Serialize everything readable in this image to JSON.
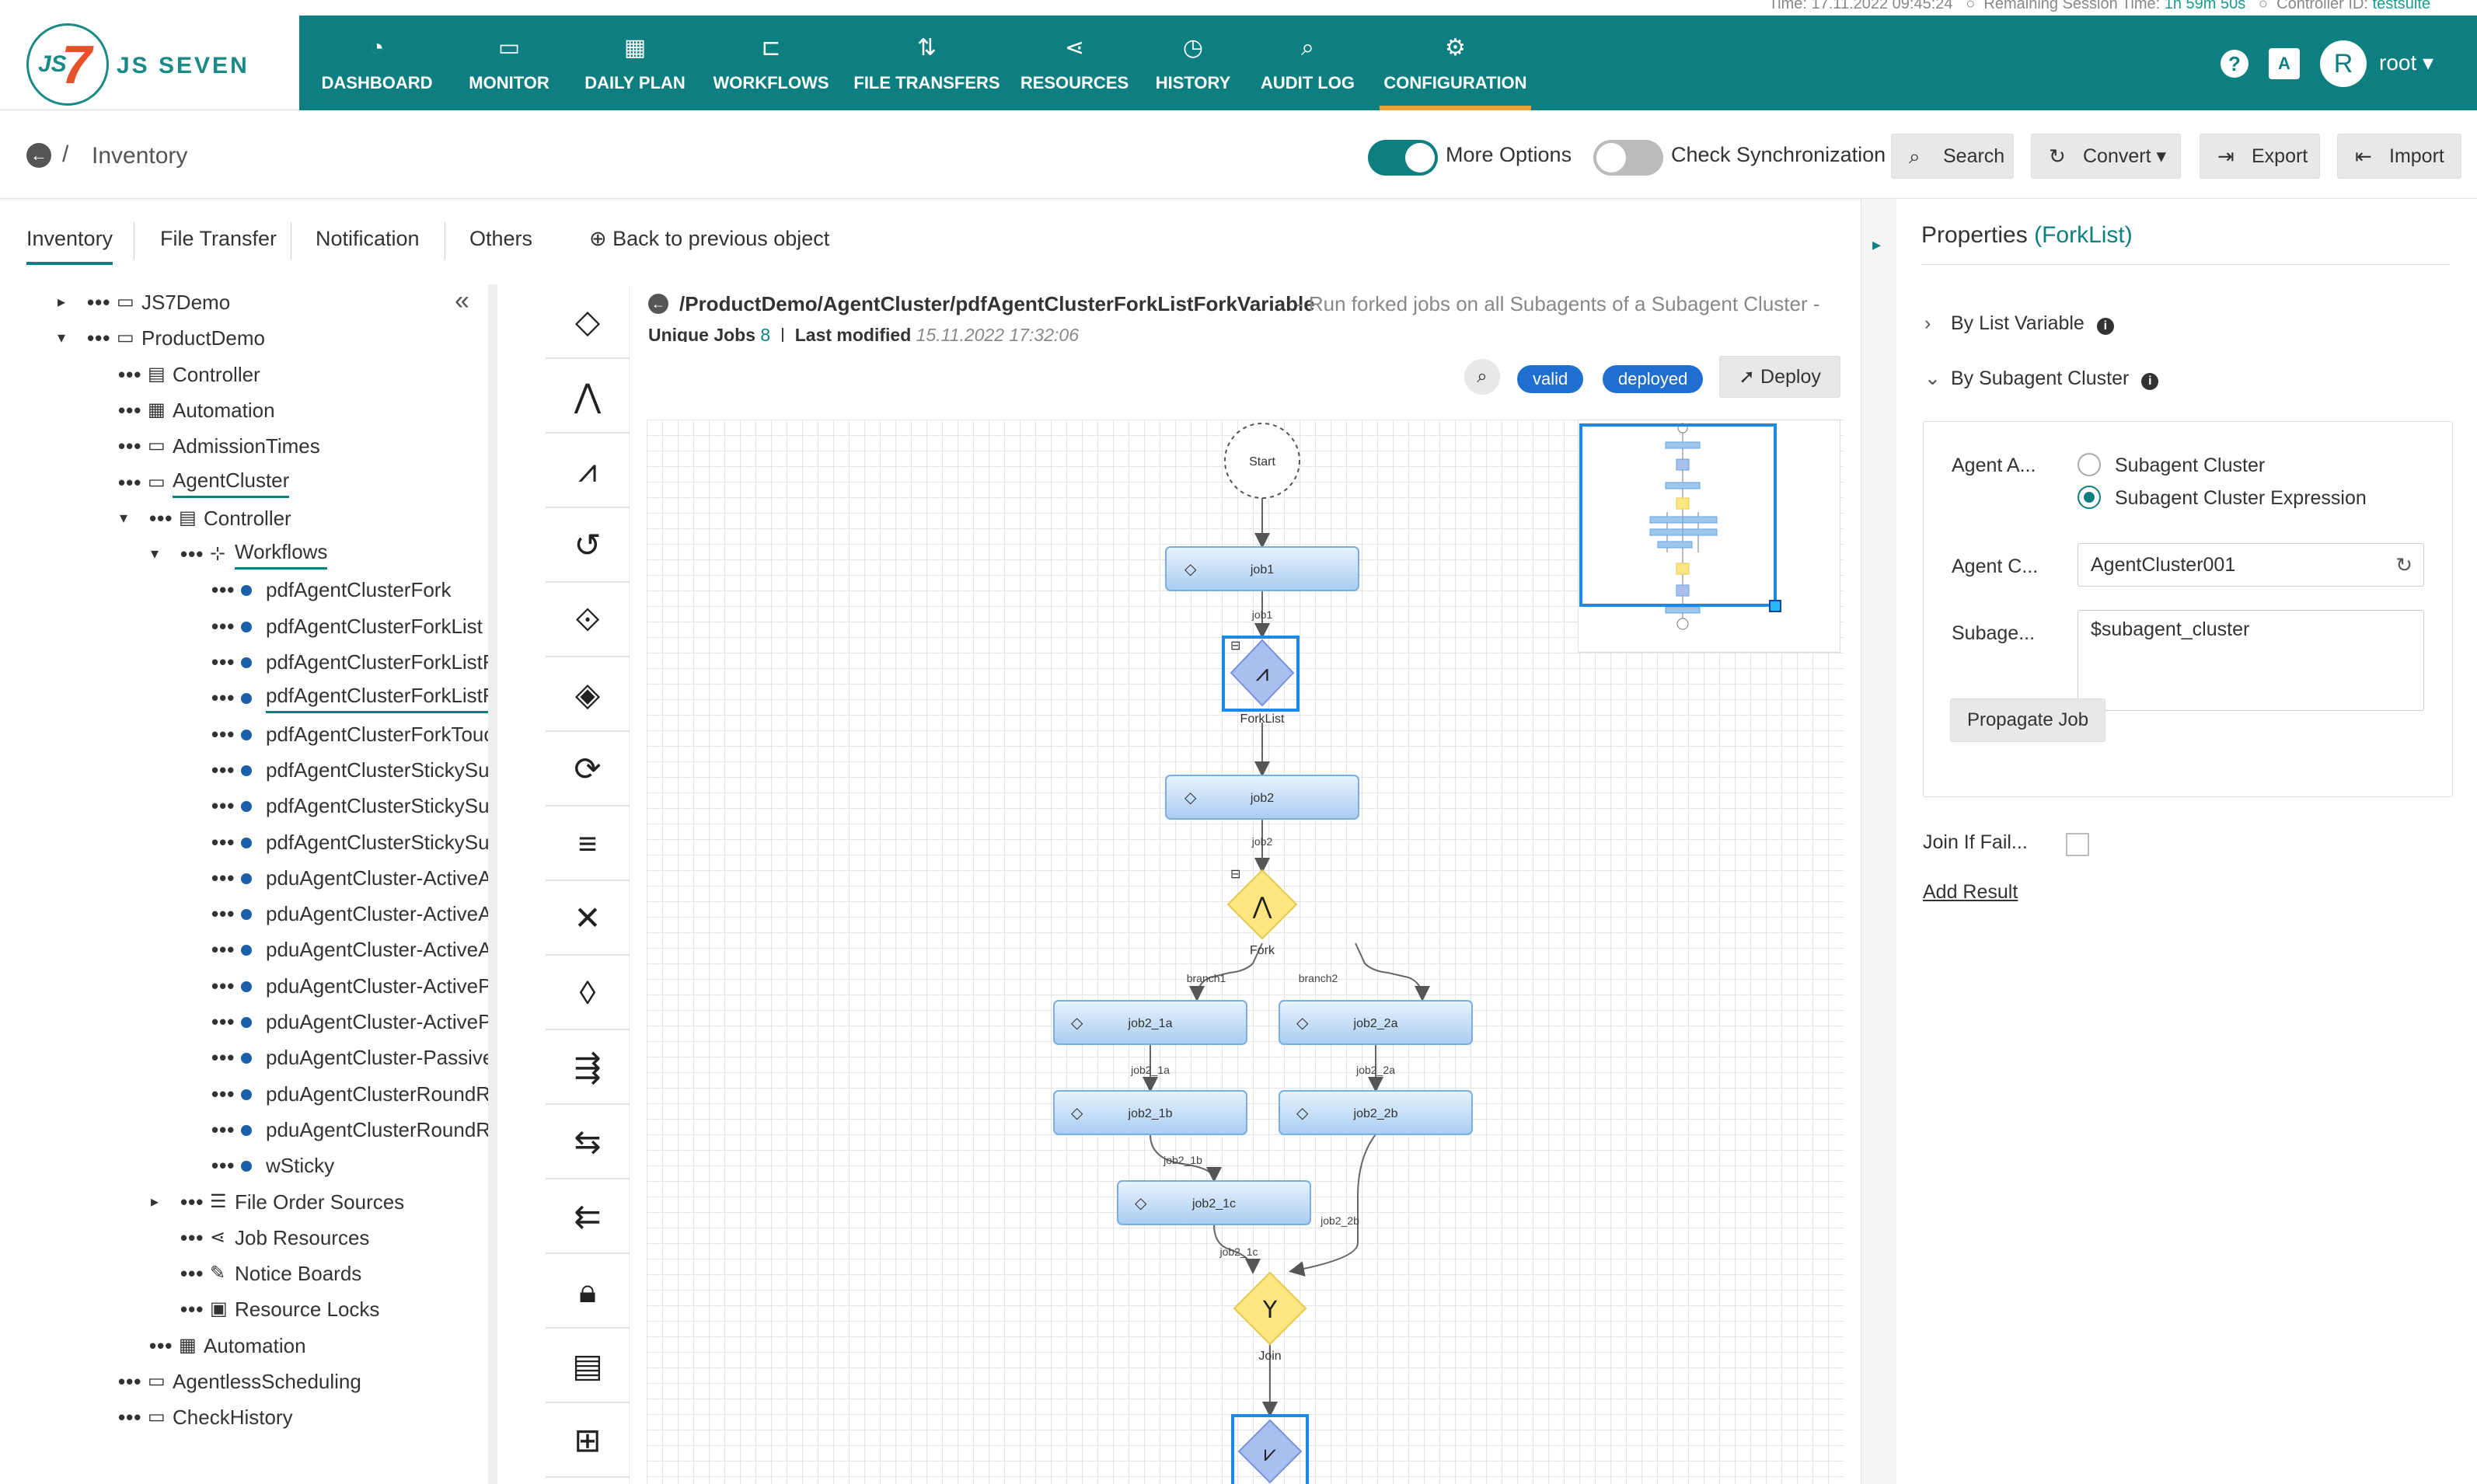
{
  "status_strip": {
    "time_label": "Time:",
    "time_value": "17.11.2022 09:45:24",
    "session_label": "Remaining Session Time:",
    "session_value": "1h 59m 50s",
    "controller_label": "Controller ID:",
    "controller_value": "testsuite"
  },
  "brand": {
    "name": "JS SEVEN",
    "mark_js": "JS",
    "mark_seven": "7"
  },
  "nav": {
    "items": [
      {
        "label": "DASHBOARD",
        "icon": "dashboard-gauge-icon"
      },
      {
        "label": "MONITOR",
        "icon": "monitor-icon"
      },
      {
        "label": "DAILY PLAN",
        "icon": "calendar-clock-icon"
      },
      {
        "label": "WORKFLOWS",
        "icon": "workflow-icon"
      },
      {
        "label": "FILE TRANSFERS",
        "icon": "arrows-updown-icon"
      },
      {
        "label": "RESOURCES",
        "icon": "share-icon"
      },
      {
        "label": "HISTORY",
        "icon": "history-clock-icon"
      },
      {
        "label": "AUDIT LOG",
        "icon": "audit-search-icon"
      },
      {
        "label": "CONFIGURATION",
        "icon": "gear-icon"
      }
    ],
    "active": "CONFIGURATION",
    "user_initial": "R",
    "user_name": "root",
    "help": "?",
    "lang": "A"
  },
  "subheader": {
    "breadcrumb": "Inventory",
    "more_options": "More Options",
    "check_sync": "Check Synchronization",
    "search": "Search",
    "convert": "Convert",
    "export": "Export",
    "import": "Import"
  },
  "left_tabs": {
    "tabs": [
      "Inventory",
      "File Transfer",
      "Notification",
      "Others"
    ],
    "back": "Back to previous object"
  },
  "tree": [
    {
      "label": "JS7Demo",
      "type": "folder"
    },
    {
      "label": "ProductDemo",
      "type": "folder-open"
    },
    {
      "label": "Controller",
      "type": "doc"
    },
    {
      "label": "Automation",
      "type": "calendar"
    },
    {
      "label": "AdmissionTimes",
      "type": "folder"
    },
    {
      "label": "AgentCluster",
      "type": "folder-open"
    },
    {
      "label": "Controller",
      "type": "doc"
    },
    {
      "label": "Workflows",
      "type": "workflow"
    },
    {
      "label": "pdfAgentClusterFork",
      "type": "item"
    },
    {
      "label": "pdfAgentClusterForkList",
      "type": "item"
    },
    {
      "label": "pdfAgentClusterForkListFo",
      "type": "item"
    },
    {
      "label": "pdfAgentClusterForkListFo",
      "type": "item"
    },
    {
      "label": "pdfAgentClusterForkTouch",
      "type": "item"
    },
    {
      "label": "pdfAgentClusterStickySuba",
      "type": "item"
    },
    {
      "label": "pdfAgentClusterStickySuba",
      "type": "item"
    },
    {
      "label": "pdfAgentClusterStickySuba",
      "type": "item"
    },
    {
      "label": "pduAgentCluster-ActiveAc",
      "type": "item"
    },
    {
      "label": "pduAgentCluster-ActiveAc",
      "type": "item"
    },
    {
      "label": "pduAgentCluster-ActiveAc",
      "type": "item"
    },
    {
      "label": "pduAgentCluster-ActivePa",
      "type": "item"
    },
    {
      "label": "pduAgentCluster-ActivePa",
      "type": "item"
    },
    {
      "label": "pduAgentCluster-PassivePa",
      "type": "item"
    },
    {
      "label": "pduAgentClusterRoundRol",
      "type": "item"
    },
    {
      "label": "pduAgentClusterRoundRol",
      "type": "item"
    },
    {
      "label": "wSticky",
      "type": "item"
    },
    {
      "label": "File Order Sources",
      "type": "list"
    },
    {
      "label": "Job Resources",
      "type": "share"
    },
    {
      "label": "Notice Boards",
      "type": "pin"
    },
    {
      "label": "Resource Locks",
      "type": "lock"
    },
    {
      "label": "Automation",
      "type": "calendar"
    },
    {
      "label": "AgentlessScheduling",
      "type": "folder"
    },
    {
      "label": "CheckHistory",
      "type": "folder"
    }
  ],
  "workflow": {
    "path": "/ProductDemo/AgentCluster/pdfAgentClusterForkListForkVariable",
    "description": "- Run forked jobs on all Subagents of a Subagent Cluster -",
    "unique_jobs_label": "Unique Jobs",
    "unique_jobs": "8",
    "last_modified_label": "Last modified",
    "last_modified": "15.11.2022 17:32:06",
    "badge_valid": "valid",
    "badge_deployed": "deployed",
    "deploy": "Deploy",
    "nodes": {
      "start": "Start",
      "job1": "job1",
      "forklist": "ForkList",
      "job2": "job2",
      "fork": "Fork",
      "job2_1a": "job2_1a",
      "job2_2a": "job2_2a",
      "job2_1b": "job2_1b",
      "job2_2b": "job2_2b",
      "job2_1c": "job2_1c",
      "join": "Join"
    },
    "edges": {
      "e_job1": "job1",
      "e_job2": "job2",
      "e_branch1": "branch1",
      "e_branch2": "branch2",
      "e_job2_1a": "job2_1a",
      "e_job2_2a": "job2_2a",
      "e_job2_1b": "job2_1b",
      "e_job2_2b": "job2_2b",
      "e_job2_1c": "job2_1c"
    }
  },
  "toolbar_tools": [
    "job-icon",
    "fork-icon",
    "forklist-icon",
    "retry-icon",
    "if-icon",
    "try-icon",
    "cycle-icon",
    "finish-icon",
    "fail-icon",
    "prompt-icon",
    "postnotice-icon",
    "consumenotice-icon",
    "break-icon",
    "lock-icon",
    "clipboard-icon",
    "addorder-icon"
  ],
  "properties": {
    "title": "Properties",
    "subtitle": "(ForkList)",
    "by_list_variable": "By List Variable",
    "by_subagent_cluster": "By Subagent Cluster",
    "agent_assignment_label": "Agent A...",
    "radio_subagent_cluster": "Subagent Cluster",
    "radio_subagent_cluster_expression": "Subagent Cluster Expression",
    "agent_cluster_label": "Agent C...",
    "agent_cluster_value": "AgentCluster001",
    "subagent_label": "Subage...",
    "subagent_value": "$subagent_cluster",
    "propagate_job": "Propagate Job",
    "join_if_failed": "Join If Fail...",
    "add_result": "Add Result"
  },
  "colors": {
    "primary": "#0e7f80",
    "accent_underline": "#e9a23b",
    "job_node": "#b7d7f5",
    "fork_node": "#ffe680",
    "badge": "#1f6fd0"
  }
}
